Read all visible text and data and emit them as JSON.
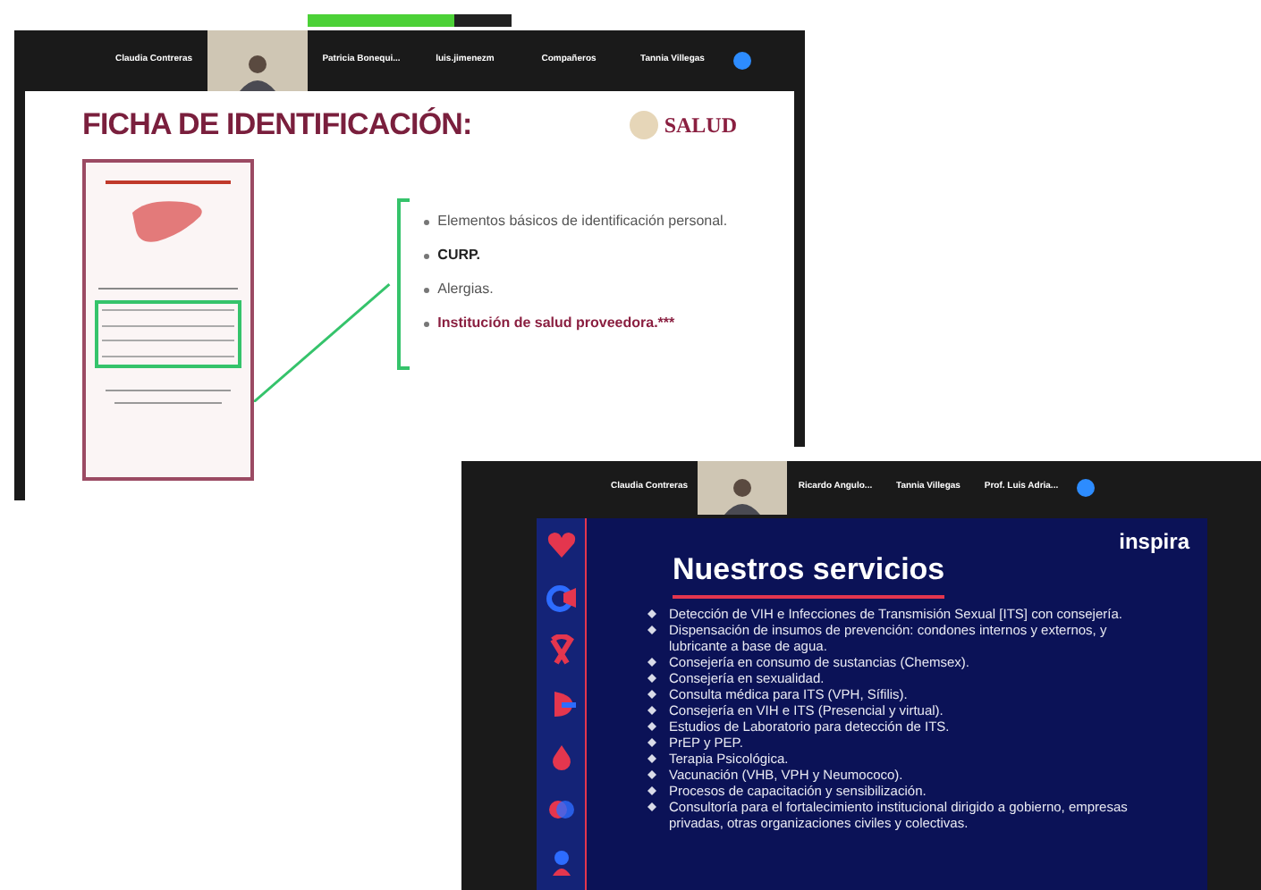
{
  "screen_1": {
    "participants": [
      {
        "kind": "name",
        "label": "Claudia Contreras"
      },
      {
        "kind": "video"
      },
      {
        "kind": "name",
        "label": "Patricia Bonequi..."
      },
      {
        "kind": "name",
        "label": "luis.jimenezm"
      },
      {
        "kind": "name",
        "label": "Compañeros"
      },
      {
        "kind": "name",
        "label": "Tannia Villegas"
      }
    ],
    "slide": {
      "title": "FICHA DE IDENTIFICACIÓN:",
      "logo": "SALUD",
      "bullets": [
        {
          "text": "Elementos básicos de identificación personal.",
          "kind": "plain"
        },
        {
          "text": "CURP.",
          "kind": "bold"
        },
        {
          "text": "Alergias.",
          "kind": "plain"
        },
        {
          "text": "Institución de salud proveedora.***",
          "kind": "accent"
        }
      ]
    }
  },
  "screen_2": {
    "participants": [
      {
        "kind": "name",
        "label": "Claudia Contreras"
      },
      {
        "kind": "video"
      },
      {
        "kind": "name",
        "label": "Ricardo Angulo..."
      },
      {
        "kind": "name",
        "label": "Tannia Villegas"
      },
      {
        "kind": "name",
        "label": "Prof. Luis Adria..."
      }
    ],
    "slide": {
      "title": "Nuestros servicios",
      "logo": "inspira",
      "bullets": [
        "Detección de VIH e Infecciones de Transmisión Sexual [ITS] con consejería.",
        "Dispensación de insumos de prevención: condones internos y externos, y lubricante a base de agua.",
        "Consejería en consumo de sustancias (Chemsex).",
        "Consejería en sexualidad.",
        "Consulta médica para ITS (VPH, Sífilis).",
        "Consejería en VIH e ITS (Presencial y virtual).",
        "Estudios de Laboratorio para detección de ITS.",
        "PrEP y PEP.",
        "Terapia Psicológica.",
        "Vacunación (VHB, VPH y Neumococo).",
        "Procesos de capacitación y sensibilización.",
        "Consultoría para el fortalecimiento institucional dirigido a gobierno, empresas privadas, otras organizaciones civiles y colectivas."
      ]
    }
  }
}
